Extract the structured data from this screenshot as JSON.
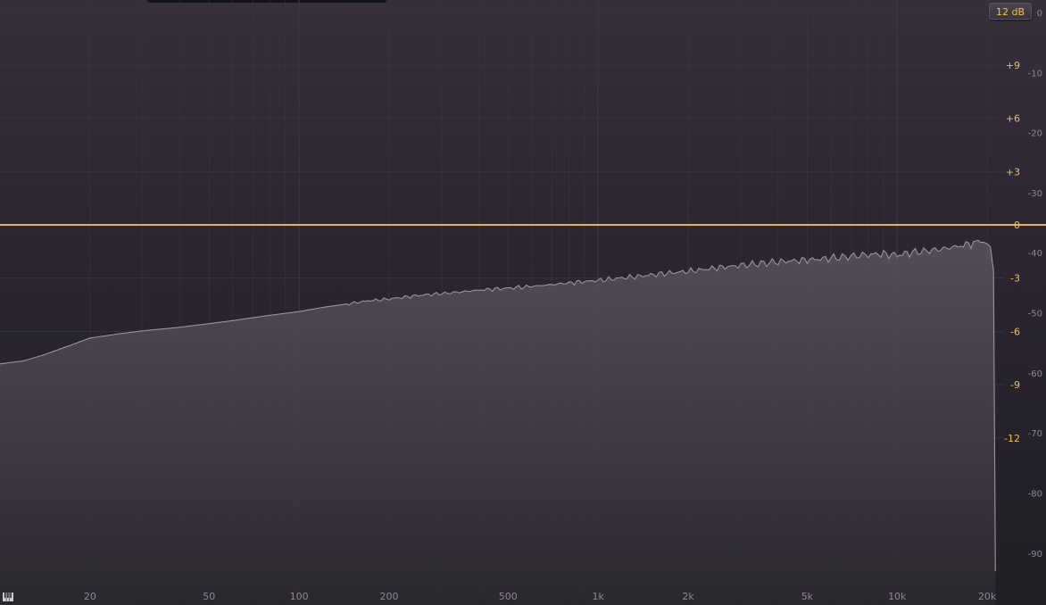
{
  "app": {
    "range_button": "12 dB",
    "colors": {
      "background_top": "#35303a",
      "background_bottom": "#211e25",
      "grid": "#3d3844",
      "gain_label": "#f2c14e",
      "zero_line": "#f2b233",
      "spectrum_fill": "#5a5460",
      "spectrum_stroke": "#9a94a0",
      "scale_label": "#8c8794"
    }
  },
  "icons": {
    "piano": "piano-keyboard-icon"
  },
  "chart_data": {
    "type": "area",
    "x_scale": "log",
    "xlim": [
      10,
      22000
    ],
    "x_ticks": [
      {
        "value": 20,
        "label": "20"
      },
      {
        "value": 50,
        "label": "50"
      },
      {
        "value": 100,
        "label": "100"
      },
      {
        "value": 200,
        "label": "200"
      },
      {
        "value": 500,
        "label": "500"
      },
      {
        "value": 1000,
        "label": "1k"
      },
      {
        "value": 2000,
        "label": "2k"
      },
      {
        "value": 5000,
        "label": "5k"
      },
      {
        "value": 10000,
        "label": "10k"
      },
      {
        "value": 20000,
        "label": "20k"
      }
    ],
    "x_grid": [
      20,
      30,
      40,
      50,
      60,
      70,
      80,
      90,
      100,
      200,
      300,
      400,
      500,
      600,
      700,
      800,
      900,
      1000,
      2000,
      3000,
      4000,
      5000,
      6000,
      7000,
      8000,
      9000,
      10000,
      20000
    ],
    "gain_scale": {
      "range": [
        -12,
        12
      ],
      "ticks": [
        {
          "value": 9,
          "label": "+9"
        },
        {
          "value": 6,
          "label": "+6"
        },
        {
          "value": 3,
          "label": "+3"
        },
        {
          "value": 0,
          "label": "0"
        },
        {
          "value": -3,
          "label": "-3"
        },
        {
          "value": -6,
          "label": "-6"
        },
        {
          "value": -9,
          "label": "-9"
        },
        {
          "value": -12,
          "label": "-12"
        }
      ]
    },
    "level_scale": {
      "range": [
        -93,
        0
      ],
      "ticks": [
        {
          "value": 0,
          "label": "0"
        },
        {
          "value": -10,
          "label": "-10"
        },
        {
          "value": -20,
          "label": "-20"
        },
        {
          "value": -30,
          "label": "-30"
        },
        {
          "value": -40,
          "label": "-40"
        },
        {
          "value": -50,
          "label": "-50"
        },
        {
          "value": -60,
          "label": "-60"
        },
        {
          "value": -70,
          "label": "-70"
        },
        {
          "value": -80,
          "label": "-80"
        },
        {
          "value": -90,
          "label": "-90"
        }
      ]
    },
    "zero_line": 0,
    "spectrum": {
      "x": [
        10,
        12,
        14,
        17,
        20,
        25,
        30,
        40,
        50,
        60,
        80,
        100,
        120,
        150,
        170,
        200,
        250,
        300,
        350,
        400,
        500,
        600,
        700,
        800,
        900,
        1000,
        1200,
        1500,
        1700,
        2000,
        2500,
        3000,
        3500,
        4000,
        5000,
        6000,
        7000,
        8000,
        9000,
        10000,
        11000,
        12000,
        14000,
        16000,
        18000,
        19000,
        20000,
        20500,
        21000,
        21300
      ],
      "y": [
        -58.5,
        -58.0,
        -57.0,
        -55.5,
        -54.2,
        -53.5,
        -53.0,
        -52.4,
        -51.8,
        -51.3,
        -50.4,
        -49.8,
        -49.1,
        -48.4,
        -48.0,
        -47.7,
        -47.1,
        -46.8,
        -46.5,
        -46.2,
        -45.9,
        -45.6,
        -45.3,
        -45.0,
        -44.8,
        -44.6,
        -44.2,
        -43.7,
        -43.4,
        -43.1,
        -42.5,
        -42.1,
        -41.8,
        -41.5,
        -41.2,
        -40.9,
        -40.6,
        -40.3,
        -40.2,
        -40.4,
        -40.0,
        -39.8,
        -39.4,
        -38.9,
        -38.4,
        -38.0,
        -38.5,
        -39.0,
        -43.0,
        -93.0
      ]
    }
  }
}
